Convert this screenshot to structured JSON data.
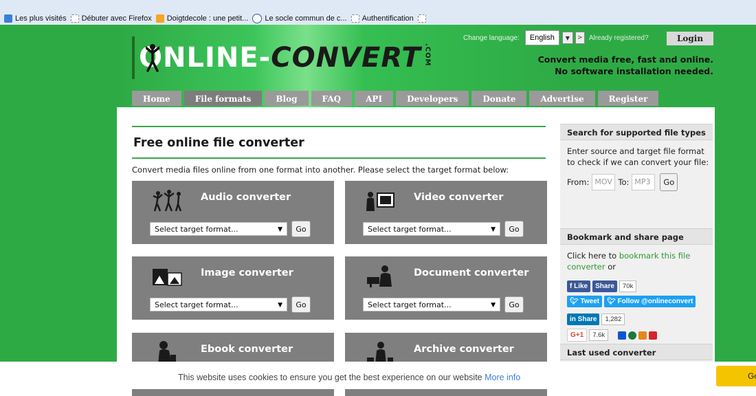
{
  "bookmarks": [
    {
      "label": "Les plus visités",
      "icon": "blue-square-icon"
    },
    {
      "label": "Débuter avec Firefox",
      "icon": "dashed-page-icon"
    },
    {
      "label": "Doigtdecole : une petit...",
      "icon": "rss-icon"
    },
    {
      "label": "Le socle commun de c...",
      "icon": "circle-e-icon"
    },
    {
      "label": "Authentification",
      "icon": "dashed-page-icon"
    }
  ],
  "header": {
    "logo_online": "ONLINE-",
    "logo_convert": "CONVERT",
    "logo_com": ".COM",
    "change_language_label": "Change language:",
    "language_value": "English",
    "lang_go": ">",
    "already_registered": "Already registered?",
    "login": "Login",
    "tagline_1": "Convert media free, fast and online.",
    "tagline_2": "No software installation needed."
  },
  "nav": [
    "Home",
    "File formats",
    "Blog",
    "FAQ",
    "API",
    "Developers",
    "Donate",
    "Advertise",
    "Register"
  ],
  "main": {
    "title": "Free online file converter",
    "intro": "Convert media files online from one format into another. Please select the target format below:",
    "select_placeholder": "Select target format...",
    "go_label": "Go",
    "converters": [
      {
        "title": "Audio converter",
        "icon": "dancers-icon"
      },
      {
        "title": "Video converter",
        "icon": "video-screen-icon"
      },
      {
        "title": "Image converter",
        "icon": "image-frames-icon"
      },
      {
        "title": "Document converter",
        "icon": "document-desk-icon"
      },
      {
        "title": "Ebook converter",
        "icon": "reader-icon"
      },
      {
        "title": "Archive converter",
        "icon": "archive-icon"
      }
    ]
  },
  "sidebar": {
    "search_head": "Search for supported file types",
    "search_desc": "Enter source and target file format to check if we can convert your file:",
    "from_label": "From:",
    "from_placeholder": "MOV",
    "to_label": "To:",
    "to_placeholder": "MP3",
    "go_label": "Go",
    "bookmark_head": "Bookmark and share page",
    "bookmark_pre": "Click here to ",
    "bookmark_link": "bookmark this file converter",
    "bookmark_post": " or",
    "fb_like": "Like",
    "fb_share": "Share",
    "fb_count": "70k",
    "tweet": "Tweet",
    "follow": "Follow @onlineconvert",
    "li_share": "Share",
    "li_count": "1,282",
    "gplus": "G+1",
    "gplus_count": "7.6k",
    "last_used_head": "Last used converter"
  },
  "cookie": {
    "text": "This website uses cookies to ensure you get the best experience on our website ",
    "more": "More info",
    "button": "Go"
  }
}
